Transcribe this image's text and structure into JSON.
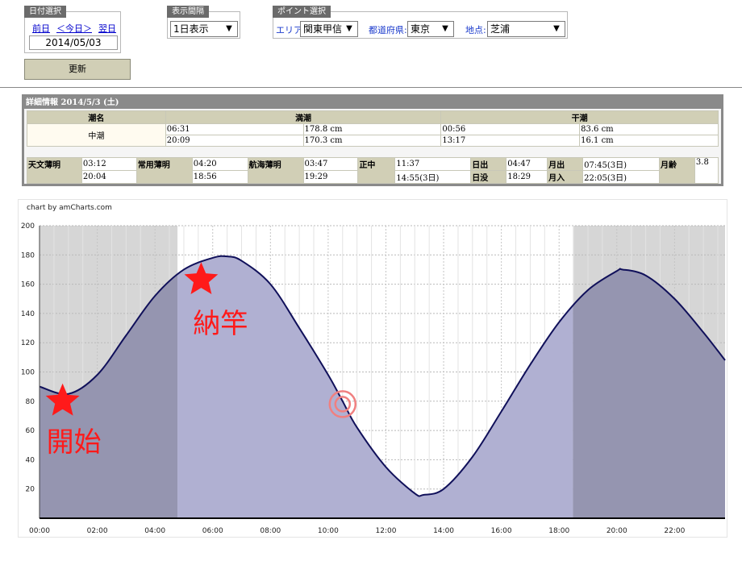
{
  "date_group": {
    "tab": "日付選択",
    "prev": "前日",
    "today": "＜今日＞",
    "next": "翌日",
    "date_value": "2014/05/03"
  },
  "interval_group": {
    "tab": "表示間隔",
    "selected": "1日表示"
  },
  "point_group": {
    "tab": "ポイント選択",
    "area_label": "エリア:",
    "area_value": "関東甲信",
    "pref_label": "都道府県:",
    "pref_value": "東京",
    "spot_label": "地点:",
    "spot_value": "芝浦"
  },
  "update_button": "更新",
  "detail": {
    "title": "詳細情報  2014/5/3 (土)",
    "headers": {
      "tide_name": "潮名",
      "high": "満潮",
      "low": "干潮"
    },
    "tide_name": "中潮",
    "high_rows": [
      {
        "time": "06:31",
        "height": "178.8 cm"
      },
      {
        "time": "20:09",
        "height": "170.3 cm"
      }
    ],
    "low_rows": [
      {
        "time": "00:56",
        "height": "83.6 cm"
      },
      {
        "time": "13:17",
        "height": "16.1 cm"
      }
    ],
    "astro": {
      "tenmon_label": "天文薄明",
      "tenmon_1": "03:12",
      "tenmon_2": "20:04",
      "joyo_label": "常用薄明",
      "joyo_1": "04:20",
      "joyo_2": "18:56",
      "kokai_label": "航海薄明",
      "kokai_1": "03:47",
      "kokai_2": "19:29",
      "nanchu_label": "正中",
      "nanchu_1": "11:37",
      "nanchu_2": "14:55(3日)",
      "sunrise_label": "日出",
      "sunrise": "04:47",
      "sunset_label": "日没",
      "sunset": "18:29",
      "moonrise_label": "月出",
      "moonrise": "07:45(3日)",
      "moonset_label": "月入",
      "moonset": "22:05(3日)",
      "moonage_label": "月齢",
      "moonage": "3.8"
    }
  },
  "chart_credit": "chart by amCharts.com",
  "annotations": {
    "start_text": "開始",
    "end_text": "納竿",
    "star_color": "#ff1a1a",
    "target_color": "#f08080"
  },
  "colors": {
    "night_band": "#d6d6d6",
    "fill_day": "#b0b0d2",
    "fill_night": "#9595b0",
    "line": "#10105a"
  },
  "chart_data": {
    "type": "area",
    "x_labels": [
      "00:00",
      "02:00",
      "04:00",
      "06:00",
      "08:00",
      "10:00",
      "12:00",
      "14:00",
      "16:00",
      "18:00",
      "20:00",
      "22:00"
    ],
    "y_ticks": [
      20,
      40,
      60,
      80,
      100,
      120,
      140,
      160,
      180,
      200
    ],
    "ylim": [
      0,
      200
    ],
    "xlim_hours": [
      0,
      23.75
    ],
    "night_until_hour": 4.78,
    "night_from_hour": 18.48,
    "points": [
      [
        0,
        90
      ],
      [
        1,
        85
      ],
      [
        2,
        98
      ],
      [
        3,
        125
      ],
      [
        4,
        152
      ],
      [
        5,
        170
      ],
      [
        6,
        178
      ],
      [
        6.5,
        179
      ],
      [
        7,
        176
      ],
      [
        8,
        160
      ],
      [
        9,
        130
      ],
      [
        10,
        98
      ],
      [
        10.5,
        80
      ],
      [
        11,
        62
      ],
      [
        12,
        35
      ],
      [
        13,
        17
      ],
      [
        13.3,
        16
      ],
      [
        14,
        20
      ],
      [
        15,
        42
      ],
      [
        16,
        73
      ],
      [
        17,
        105
      ],
      [
        18,
        134
      ],
      [
        19,
        156
      ],
      [
        20,
        169
      ],
      [
        20.2,
        170
      ],
      [
        21,
        166
      ],
      [
        22,
        150
      ],
      [
        23,
        127
      ],
      [
        23.75,
        108
      ]
    ],
    "marker_start": [
      0.8,
      80
    ],
    "marker_end": [
      5.6,
      163
    ],
    "marker_target": [
      10.5,
      78
    ]
  }
}
